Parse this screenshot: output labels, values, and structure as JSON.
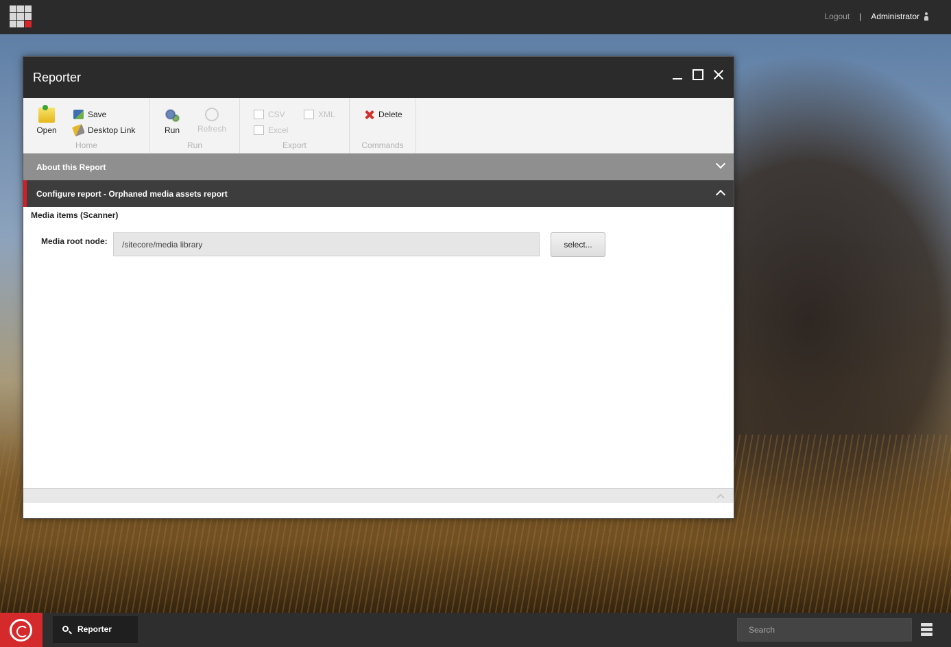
{
  "topbar": {
    "logout_label": "Logout",
    "separator": "|",
    "user_name": "Administrator"
  },
  "window": {
    "title": "Reporter"
  },
  "ribbon": {
    "home": {
      "group_label": "Home",
      "open_label": "Open",
      "save_label": "Save",
      "desktop_link_label": "Desktop Link"
    },
    "run": {
      "group_label": "Run",
      "run_label": "Run",
      "refresh_label": "Refresh"
    },
    "export": {
      "group_label": "Export",
      "csv_label": "CSV",
      "excel_label": "Excel",
      "xml_label": "XML"
    },
    "commands": {
      "group_label": "Commands",
      "delete_label": "Delete"
    }
  },
  "accordion": {
    "about_label": "About this Report",
    "config_label": "Configure report - Orphaned media assets report"
  },
  "config": {
    "section_title": "Media items (Scanner)",
    "media_root_label": "Media root node:",
    "media_root_value": "/sitecore/media library",
    "select_button_label": "select..."
  },
  "taskbar": {
    "active_app_label": "Reporter",
    "search_placeholder": "Search"
  },
  "colors": {
    "accent_red": "#d42a2b",
    "dark_bar": "#2b2b2b"
  }
}
